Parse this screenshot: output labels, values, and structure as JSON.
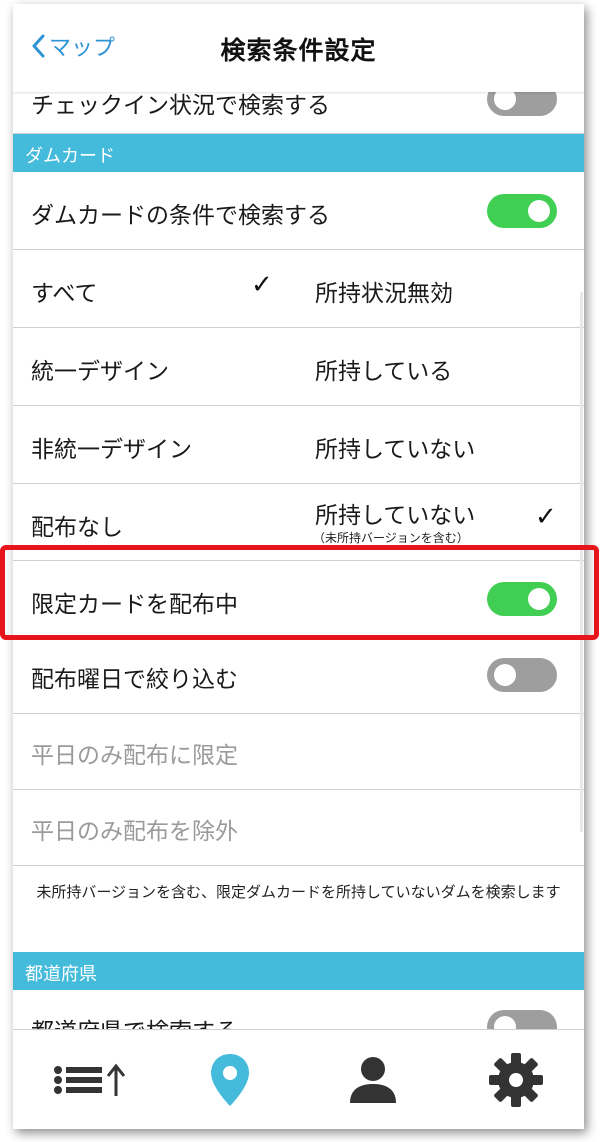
{
  "nav": {
    "back_label": "マップ",
    "title": "検索条件設定"
  },
  "rows": {
    "checkin": "チェックイン状況で検索する",
    "dam_card_toggle": "ダムカードの条件で検索する",
    "limited_card": "限定カードを配布中",
    "weekday_filter": "配布曜日で絞り込む",
    "weekday_only": "平日のみ配布に限定",
    "weekday_exclude": "平日のみ配布を除外",
    "prefecture_toggle": "都道府県で検索する"
  },
  "sections": {
    "dam_card": "ダムカード",
    "prefecture": "都道府県"
  },
  "options": {
    "design": [
      "すべて",
      "統一デザイン",
      "非統一デザイン",
      "配布なし"
    ],
    "possession": [
      "所持状況無効",
      "所持している",
      "所持していない",
      "所持していない"
    ],
    "possession_sub": "（未所持バージョンを含む）"
  },
  "note": "未所持バージョンを含む、限定ダムカードを所持していないダムを検索します",
  "toggles": {
    "checkin": false,
    "dam_card": true,
    "limited_card": true,
    "weekday_filter": false,
    "prefecture": false
  },
  "colors": {
    "accent": "#45bbdc",
    "toggle_on": "#40cf52",
    "toggle_off": "#9e9e9e",
    "back_link": "#2f94d6",
    "highlight": "#e8141b"
  },
  "icons": {
    "tab1": "list-sort-icon",
    "tab2": "map-pin-icon",
    "tab3": "person-icon",
    "tab4": "gear-icon"
  }
}
